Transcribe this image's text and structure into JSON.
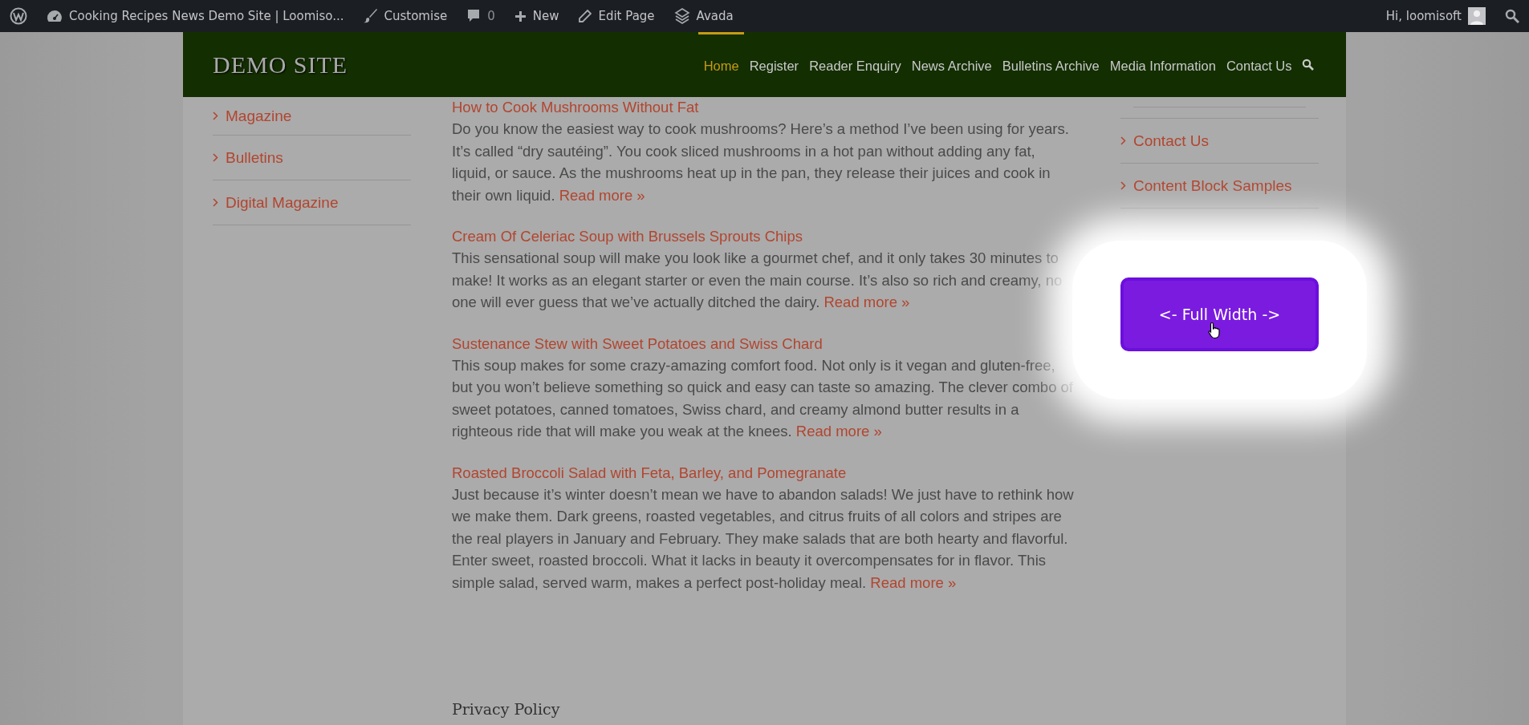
{
  "admin_bar": {
    "site_title": "Cooking Recipes News Demo Site | Loomiso...",
    "customise": "Customise",
    "comments": "0",
    "new": "New",
    "edit": "Edit Page",
    "theme": "Avada",
    "greeting": "Hi, loomisoft"
  },
  "header": {
    "logo": "DEMO SITE",
    "nav": [
      {
        "label": "Home",
        "selected": true
      },
      {
        "label": "Register",
        "selected": false
      },
      {
        "label": "Reader Enquiry",
        "selected": false
      },
      {
        "label": "News Archive",
        "selected": false
      },
      {
        "label": "Bulletins Archive",
        "selected": false
      },
      {
        "label": "Media Information",
        "selected": false
      },
      {
        "label": "Contact Us",
        "selected": false
      }
    ]
  },
  "left_sidebar": [
    "Magazine",
    "Bulletins",
    "Digital Magazine"
  ],
  "posts": [
    {
      "title": "How to Cook Mushrooms Without Fat",
      "text": "Do you know the easiest way to cook mushrooms? Here’s a method I’ve been using for years. It’s called “dry sautéing”. You cook sliced mushrooms in a hot pan without adding any fat, liquid, or sauce. As the mushrooms heat up in the pan, they release their juices and cook in their own liquid.",
      "more": "Read more »"
    },
    {
      "title": "Cream Of Celeriac Soup with Brussels Sprouts Chips",
      "text": "This sensational soup will make you look like a gourmet chef, and it only takes 30 minutes to make! It works as an elegant starter or even the main course. It’s also so rich and creamy, no one will ever guess that we’ve actually ditched the dairy.",
      "more": "Read more »"
    },
    {
      "title": "Sustenance Stew with Sweet Potatoes and Swiss Chard",
      "text": "This soup makes for some crazy-amazing comfort food. Not only is it vegan and gluten-free, but you won’t believe something so quick and easy can taste so amazing. The clever combo of sweet potatoes, canned tomatoes, Swiss chard, and creamy almond butter results in a righteous ride that will make you weak at the knees.",
      "more": "Read more »"
    },
    {
      "title": "Roasted Broccoli Salad with Feta, Barley, and Pomegranate",
      "text": "Just because it’s winter doesn’t mean we have to abandon salads! We just have to rethink how we make them. Dark greens, roasted vegetables, and citrus fruits of all colors and stripes are the real players in January and February. They make salads that are both hearty and flavorful. Enter sweet, roasted broccoli. What it lacks in beauty it overcompensates for in flavor. This simple salad, served warm, makes a perfect post-holiday meal.",
      "more": "Read more »"
    }
  ],
  "footer_heading": "Privacy Policy",
  "right_sidebar": [
    "Contact Us",
    "Content Block Samples"
  ],
  "full_width_button": "<- Full Width ->"
}
